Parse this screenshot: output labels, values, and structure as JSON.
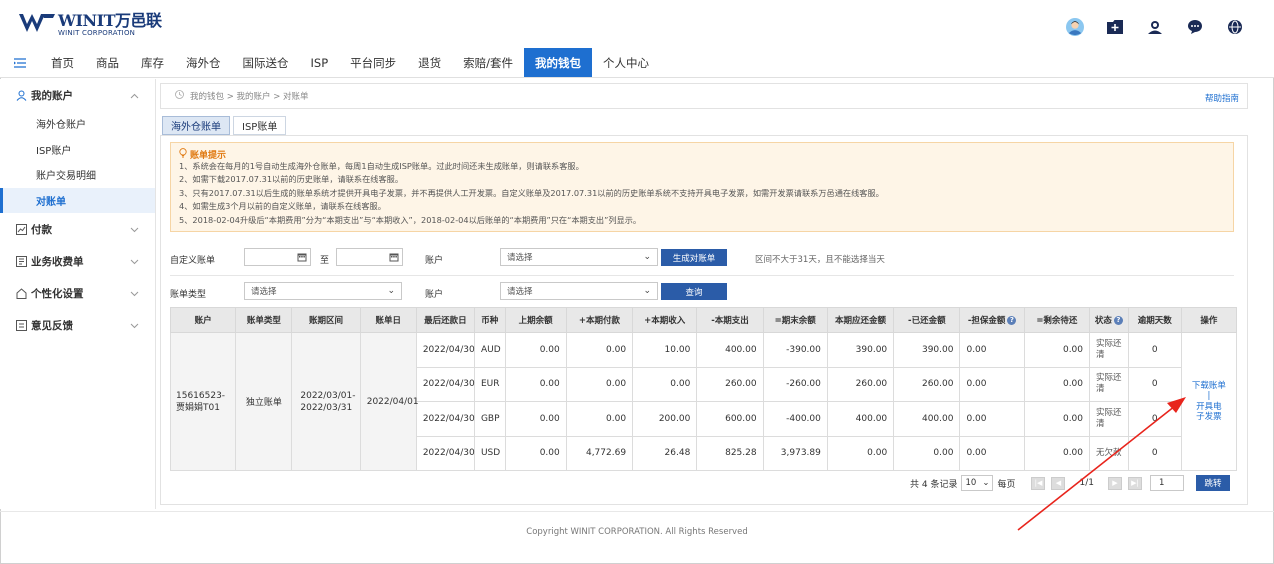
{
  "brand": {
    "name": "WINIT万邑联",
    "sub": "WINIT CORPORATION"
  },
  "header_icons": [
    "avatar",
    "folder-add-icon",
    "user-support-icon",
    "chat-icon",
    "globe-icon"
  ],
  "nav": {
    "items": [
      "首页",
      "商品",
      "库存",
      "海外仓",
      "国际送仓",
      "ISP",
      "平台同步",
      "退货",
      "索赔/套件",
      "我的钱包",
      "个人中心"
    ],
    "active": "我的钱包"
  },
  "sidebar": {
    "account_group": "我的账户",
    "account_items": [
      "海外仓账户",
      "ISP账户",
      "账户交易明细",
      "对账单"
    ],
    "active_item": "对账单",
    "groups": [
      "付款",
      "业务收费单",
      "个性化设置",
      "意见反馈"
    ]
  },
  "breadcrumb": "我的钱包 > 我的账户 > 对账单",
  "help": "帮助指南",
  "tabs": [
    "海外仓账单",
    "ISP账单"
  ],
  "notice": {
    "title": "账单提示",
    "lines": [
      "1、系统会在每月的1号自动生成海外仓账单，每周1自动生成ISP账单。过此时间还未生成账单，则请联系客服。",
      "2、如需下载2017.07.31以前的历史账单，请联系在线客服。",
      "3、只有2017.07.31以后生成的账单系统才提供开具电子发票，并不再提供人工开发票。自定义账单及2017.07.31以前的历史账单系统不支持开具电子发票，如需开发票请联系万邑通在线客服。",
      "4、如需生成3个月以前的自定义账单，请联系在线客服。",
      "5、2018-02-04升级后“本期费用”分为“本期支出”与“本期收入”，2018-02-04以后账单的“本期费用”只在“本期支出”列显示。"
    ]
  },
  "form": {
    "custom_label": "自定义账单",
    "to": "至",
    "account_label": "账户",
    "account_placeholder": "请选择",
    "generate_btn": "生成对账单",
    "hint": "区间不大于31天，且不能选择当天",
    "type_label": "账单类型",
    "type_placeholder": "请选择",
    "account2_label": "账户",
    "account2_placeholder": "请选择",
    "query_btn": "查询"
  },
  "table": {
    "headers": [
      "账户",
      "账单类型",
      "账期区间",
      "账单日",
      "最后还款日",
      "币种",
      "上期余额",
      "+本期付款",
      "+本期收入",
      "-本期支出",
      "=期末余额",
      "本期应还金额",
      "-已还金额",
      "-担保金额",
      "=剩余待还",
      "状态",
      "逾期天数",
      "操作"
    ],
    "account": "15616523-贾娟娟T01",
    "bill_type": "独立账单",
    "period": "2022/03/01-2022/03/31",
    "bill_date": "2022/04/01",
    "rows": [
      {
        "due": "2022/04/30",
        "cur": "AUD",
        "prev": "0.00",
        "pay": "0.00",
        "income": "10.00",
        "expense": "400.00",
        "end": "-390.00",
        "should": "390.00",
        "paid": "390.00",
        "guarantee": "0.00",
        "remain": "0.00",
        "status": "实际还清",
        "overdue": "0"
      },
      {
        "due": "2022/04/30",
        "cur": "EUR",
        "prev": "0.00",
        "pay": "0.00",
        "income": "0.00",
        "expense": "260.00",
        "end": "-260.00",
        "should": "260.00",
        "paid": "260.00",
        "guarantee": "0.00",
        "remain": "0.00",
        "status": "实际还清",
        "overdue": "0"
      },
      {
        "due": "2022/04/30",
        "cur": "GBP",
        "prev": "0.00",
        "pay": "0.00",
        "income": "200.00",
        "expense": "600.00",
        "end": "-400.00",
        "should": "400.00",
        "paid": "400.00",
        "guarantee": "0.00",
        "remain": "0.00",
        "status": "实际还清",
        "overdue": "0"
      },
      {
        "due": "2022/04/30",
        "cur": "USD",
        "prev": "0.00",
        "pay": "4,772.69",
        "income": "26.48",
        "expense": "825.28",
        "end": "3,973.89",
        "should": "0.00",
        "paid": "0.00",
        "guarantee": "0.00",
        "remain": "0.00",
        "status": "无欠款",
        "overdue": "0"
      }
    ],
    "op_download": "下载账单",
    "op_invoice": "开具电子发票"
  },
  "pager": {
    "total": "共 4 条记录",
    "size": "10",
    "per_page": "每页",
    "page": "1/1",
    "jump_value": "1",
    "go": "跳转"
  },
  "footer": "Copyright WINIT CORPORATION. All Rights Reserved",
  "colors": {
    "primary": "#1e6fd0",
    "dark_blue": "#2b5ca8",
    "brand": "#1a3b7a",
    "notice_bg": "#fef5e7",
    "notice_title": "#e07a12",
    "arrow": "#e8241c"
  }
}
